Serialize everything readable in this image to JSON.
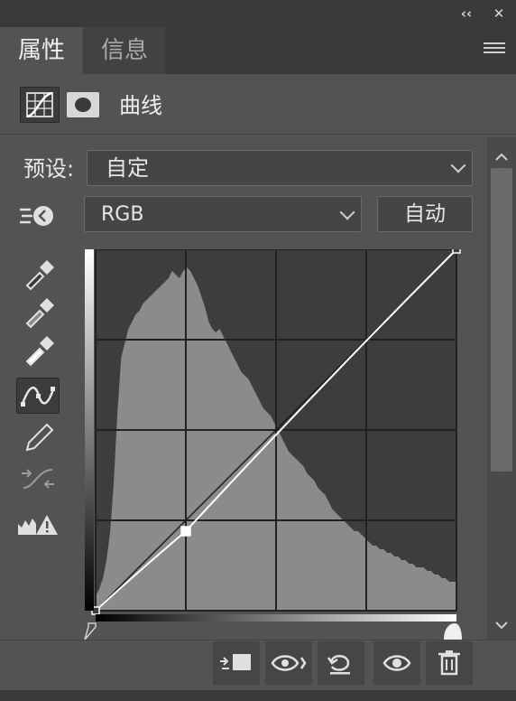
{
  "tabs": [
    {
      "label": "属性"
    },
    {
      "label": "信息"
    }
  ],
  "header": {
    "title": "曲线"
  },
  "preset": {
    "label": "预设:",
    "value": "自定"
  },
  "channel": {
    "value": "RGB"
  },
  "auto_button": {
    "label": "自动"
  },
  "curve_points": {
    "control_points": [
      [
        0,
        0
      ],
      [
        0.25,
        0.22
      ],
      [
        1,
        1
      ]
    ],
    "baseline": [
      [
        0,
        0
      ],
      [
        1,
        1
      ]
    ]
  },
  "histogram": [
    4,
    6,
    9,
    14,
    22,
    36,
    55,
    70,
    74,
    78,
    80,
    82,
    83,
    85,
    86,
    87,
    88,
    89,
    90,
    91,
    92,
    94,
    93,
    92,
    94,
    95,
    94,
    92,
    90,
    87,
    84,
    80,
    78,
    77,
    78,
    76,
    74,
    72,
    70,
    68,
    66,
    65,
    64,
    62,
    60,
    58,
    56,
    55,
    54,
    52,
    50,
    48,
    46,
    44,
    43,
    42,
    41,
    40,
    38,
    37,
    36,
    34,
    33,
    32,
    30,
    28,
    27,
    26,
    25,
    24,
    23,
    22,
    22,
    21,
    20,
    19,
    18,
    18,
    17,
    17,
    16,
    16,
    15,
    15,
    14,
    14,
    13,
    13,
    12,
    12,
    12,
    11,
    11,
    10,
    10,
    9,
    9,
    8,
    8,
    8
  ],
  "icons": {
    "collapse": "double-chevron-left-icon",
    "close": "close-icon",
    "menu": "hamburger-menu-icon"
  },
  "colors": {
    "panel": "#535353",
    "dark": "#3a3a3a",
    "accent": "#ffffff"
  }
}
